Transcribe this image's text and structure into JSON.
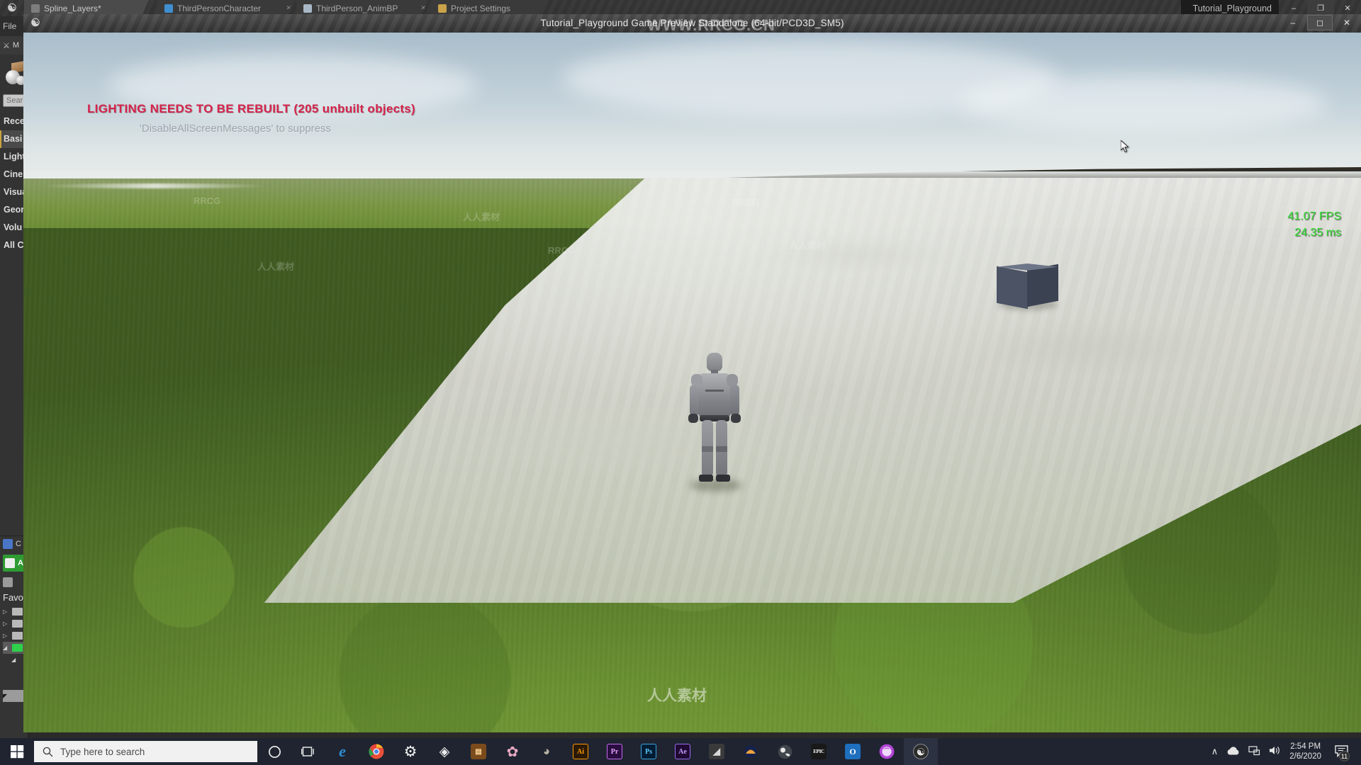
{
  "editor": {
    "logo_icon": "unreal-engine-logo-icon",
    "menu": {
      "file_label": "File"
    },
    "tabs": [
      {
        "label": "Spline_Layers*",
        "icon": "level-icon",
        "icon_color": "#7d7d7d",
        "active": true
      },
      {
        "label": "ThirdPersonCharacter",
        "icon": "blueprint-icon",
        "icon_color": "#3f8fd0",
        "active": false
      },
      {
        "label": "ThirdPerson_AnimBP",
        "icon": "anim-blueprint-icon",
        "icon_color": "#a9b8c6",
        "active": false
      },
      {
        "label": "Project Settings",
        "icon": "gear-icon",
        "icon_color": "#c9a24a",
        "active": false
      }
    ],
    "right_tab": {
      "label": "Tutorial_Playground",
      "icon": "unreal-project-icon"
    },
    "window_buttons": {
      "minimize": "–",
      "maximize": "❐",
      "close": "✕"
    },
    "place_actors": {
      "title": "M",
      "search_placeholder": "Sear",
      "categories": [
        {
          "label": "Rece",
          "selected": false
        },
        {
          "label": "Basi",
          "selected": true
        },
        {
          "label": "Light",
          "selected": false
        },
        {
          "label": "Cine",
          "selected": false
        },
        {
          "label": "Visua",
          "selected": false
        },
        {
          "label": "Geor",
          "selected": false
        },
        {
          "label": "Volu",
          "selected": false
        },
        {
          "label": "All Cl",
          "selected": false
        }
      ]
    },
    "content_browser": {
      "tab_label": "C",
      "add_new_label": "A",
      "favorites_label": "Favo",
      "tree_items": [
        {
          "arrow": "▷",
          "selected": false,
          "green": false
        },
        {
          "arrow": "▷",
          "selected": false,
          "green": false
        },
        {
          "arrow": "▷",
          "selected": false,
          "green": false
        },
        {
          "arrow": "◢",
          "selected": true,
          "green": true
        },
        {
          "arrow": "◢",
          "selected": false,
          "green": false
        },
        {
          "arrow": "◤",
          "selected": true,
          "green": false
        }
      ]
    }
  },
  "game_window": {
    "title": "Tutorial_Playground Game Preview Standalone (64-bit/PCD3D_SM5)",
    "logo_icon": "unreal-engine-logo-icon",
    "window_buttons": {
      "minimize": "–",
      "restore": "❐",
      "close": "✕"
    },
    "messages": {
      "lighting_warning": "LIGHTING NEEDS TO BE REBUILT (205 unbuilt objects)",
      "lighting_warning_color": "#d6234c",
      "suppress_hint": "'DisableAllScreenMessages' to suppress",
      "suppress_hint_color": "#9fa5ad"
    },
    "stats": {
      "fps": "41.07 FPS",
      "frametime": "24.35 ms",
      "color": "#35e235"
    },
    "scene": {
      "character_name": "third-person-mannequin",
      "cube_name": "static-mesh-cube",
      "cursor_name": "mouse-cursor"
    }
  },
  "watermarks": {
    "top": "WWW.RRCG.CN",
    "bottom": "人人素材",
    "tiles": [
      "RRCG",
      "人人素材",
      "RRCG",
      "人人素材",
      "RRCG",
      "人人素材"
    ]
  },
  "taskbar": {
    "start_label": "start-button",
    "search_placeholder": "Type here to search",
    "search_value": "",
    "icons": [
      {
        "name": "cortana-icon",
        "glyph": "○",
        "label": "",
        "color": "#e8e8e8",
        "bg": "transparent",
        "active": false
      },
      {
        "name": "task-view-icon",
        "glyph": "⧉",
        "label": "",
        "color": "#e8e8e8",
        "bg": "transparent",
        "active": false
      },
      {
        "name": "microsoft-edge-icon",
        "glyph": "e",
        "label": "",
        "color": "#2e8fd4",
        "bg": "transparent",
        "active": false
      },
      {
        "name": "google-chrome-icon",
        "glyph": "●",
        "label": "",
        "color": "#dd5144",
        "bg": "transparent",
        "active": false
      },
      {
        "name": "settings-gear-icon",
        "glyph": "⚙",
        "label": "",
        "color": "#f0f0f0",
        "bg": "transparent",
        "active": false
      },
      {
        "name": "sublime-text-icon",
        "glyph": "◈",
        "label": "",
        "color": "#e8e8e8",
        "bg": "transparent",
        "active": false
      },
      {
        "name": "winrar-icon",
        "glyph": "▤",
        "label": "",
        "color": "#e08a2a",
        "bg": "transparent",
        "active": false
      },
      {
        "name": "paint-icon",
        "glyph": "✿",
        "label": "",
        "color": "#e7b2c8",
        "bg": "transparent",
        "active": false
      },
      {
        "name": "gimp-icon",
        "glyph": "◕",
        "label": "",
        "color": "#b9b5a6",
        "bg": "transparent",
        "active": false
      },
      {
        "name": "adobe-illustrator-icon",
        "glyph": "Ai",
        "label": "Ai",
        "color": "#ff9a00",
        "bg": "#2b1a06",
        "active": false
      },
      {
        "name": "adobe-premiere-icon",
        "glyph": "Pr",
        "label": "Pr",
        "color": "#e6a0ff",
        "bg": "#2a0d40",
        "active": false
      },
      {
        "name": "adobe-photoshop-icon",
        "glyph": "Ps",
        "label": "Ps",
        "color": "#5fc9f8",
        "bg": "#021c33",
        "active": false
      },
      {
        "name": "adobe-after-effects-icon",
        "glyph": "Ae",
        "label": "Ae",
        "color": "#c49bff",
        "bg": "#1f0a33",
        "active": false
      },
      {
        "name": "nvidia-geforce-icon",
        "glyph": "◢",
        "label": "",
        "color": "#cfcfcf",
        "bg": "#3a3a3a",
        "active": false
      },
      {
        "name": "audacity-icon",
        "glyph": "◖",
        "label": "",
        "color": "#f0a23c",
        "bg": "transparent",
        "active": false
      },
      {
        "name": "obs-studio-icon",
        "glyph": "◎",
        "label": "",
        "color": "#d8d8d8",
        "bg": "transparent",
        "active": false
      },
      {
        "name": "epic-games-launcher-icon",
        "glyph": "EPIC",
        "label": "EPIC",
        "color": "#ffffff",
        "bg": "#1d1d1d",
        "active": false
      },
      {
        "name": "outlook-icon",
        "glyph": "O",
        "label": "O",
        "color": "#ffffff",
        "bg": "#1e6fbe",
        "active": false
      },
      {
        "name": "discord-icon",
        "glyph": "●",
        "label": "",
        "color": "#f2dcff",
        "bg": "#b446d6",
        "active": false
      },
      {
        "name": "unreal-engine-icon",
        "glyph": "♈",
        "label": "",
        "color": "#e8e8e8",
        "bg": "transparent",
        "active": true
      }
    ],
    "tray": {
      "chevron": "∧",
      "onedrive_icon": "cloud-icon",
      "network_icon": "network-icon",
      "volume_icon": "speaker-icon",
      "time": "2:54 PM",
      "date": "2/6/2020",
      "notifications_icon": "action-center-icon",
      "notifications_count": "11"
    }
  }
}
